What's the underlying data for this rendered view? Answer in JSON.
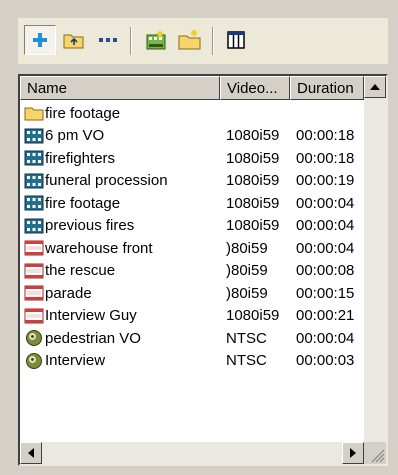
{
  "toolbar": {
    "buttons": [
      {
        "icon": "add-icon"
      },
      {
        "icon": "folder-up-icon"
      },
      {
        "icon": "more-icon"
      },
      {
        "icon": "new-bin-icon"
      },
      {
        "icon": "new-folder-icon"
      },
      {
        "icon": "columns-view-icon"
      }
    ]
  },
  "list": {
    "columns": [
      "Name",
      "Video...",
      "Duration"
    ],
    "rows": [
      {
        "name": "fire footage",
        "format": "",
        "duration": "",
        "icon": "folder-icon"
      },
      {
        "name": "6 pm VO",
        "format": "1080i59",
        "duration": "00:00:18",
        "icon": "video-clip-icon"
      },
      {
        "name": "firefighters",
        "format": "1080i59",
        "duration": "00:00:18",
        "icon": "video-clip-icon"
      },
      {
        "name": "funeral procession",
        "format": "1080i59",
        "duration": "00:00:19",
        "icon": "video-clip-icon"
      },
      {
        "name": "fire footage",
        "format": "1080i59",
        "duration": "00:00:04",
        "icon": "video-clip-icon"
      },
      {
        "name": "previous fires",
        "format": "1080i59",
        "duration": "00:00:04",
        "icon": "video-clip-icon"
      },
      {
        "name": "warehouse front",
        "format": ")80i59",
        "duration": "00:00:04",
        "icon": "sequence-icon"
      },
      {
        "name": "the rescue",
        "format": ")80i59",
        "duration": "00:00:08",
        "icon": "sequence-icon"
      },
      {
        "name": "parade",
        "format": ")80i59",
        "duration": "00:00:15",
        "icon": "sequence-icon"
      },
      {
        "name": "Interview Guy",
        "format": "1080i59",
        "duration": "00:00:21",
        "icon": "sequence-icon"
      },
      {
        "name": "pedestrian VO",
        "format": "NTSC",
        "duration": "00:00:04",
        "icon": "audio-clip-icon"
      },
      {
        "name": "Interview",
        "format": "NTSC",
        "duration": "00:00:03",
        "icon": "audio-clip-icon"
      }
    ]
  },
  "colors": {
    "panel": "#d4d0c8",
    "toolbar": "#ece9d8",
    "list_background": "#ffffff",
    "video_icon": "#1f6f8f",
    "sequence_icon": "#c94040",
    "folder_icon": "#f0c24a"
  }
}
